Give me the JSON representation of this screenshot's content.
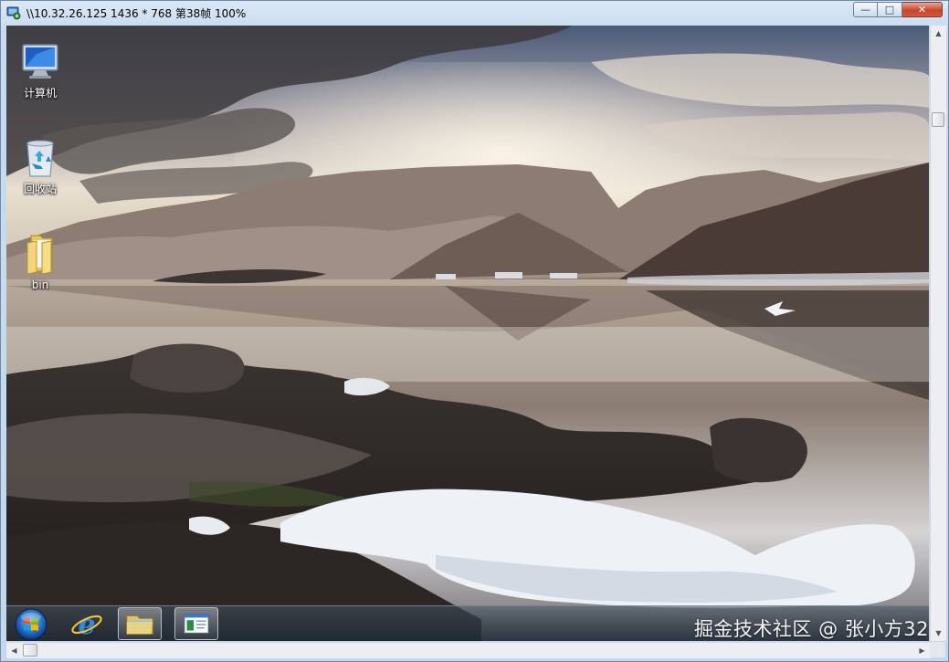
{
  "window": {
    "title": "\\\\10.32.26.125 1436 * 768 第38帧 100%",
    "minimize_glyph": "—",
    "maximize_glyph": "□",
    "close_glyph": "✕"
  },
  "desktop": {
    "icons": [
      {
        "label": "计算机",
        "icon": "computer-icon"
      },
      {
        "label": "回收站",
        "icon": "recycle-bin-icon"
      },
      {
        "label": "bin",
        "icon": "folder-icon"
      }
    ]
  },
  "taskbar": {
    "buttons": [
      {
        "name": "start",
        "icon": "windows-orb-icon"
      },
      {
        "name": "internet-explorer",
        "icon": "ie-icon"
      },
      {
        "name": "file-explorer",
        "icon": "folder-icon"
      },
      {
        "name": "window",
        "icon": "window-icon"
      }
    ]
  },
  "watermark": "掘金技术社区 @ 张小方32",
  "colors": {
    "frame": "#c4d7ec",
    "close_button": "#c8452d",
    "taskbar": "#1e2834"
  }
}
